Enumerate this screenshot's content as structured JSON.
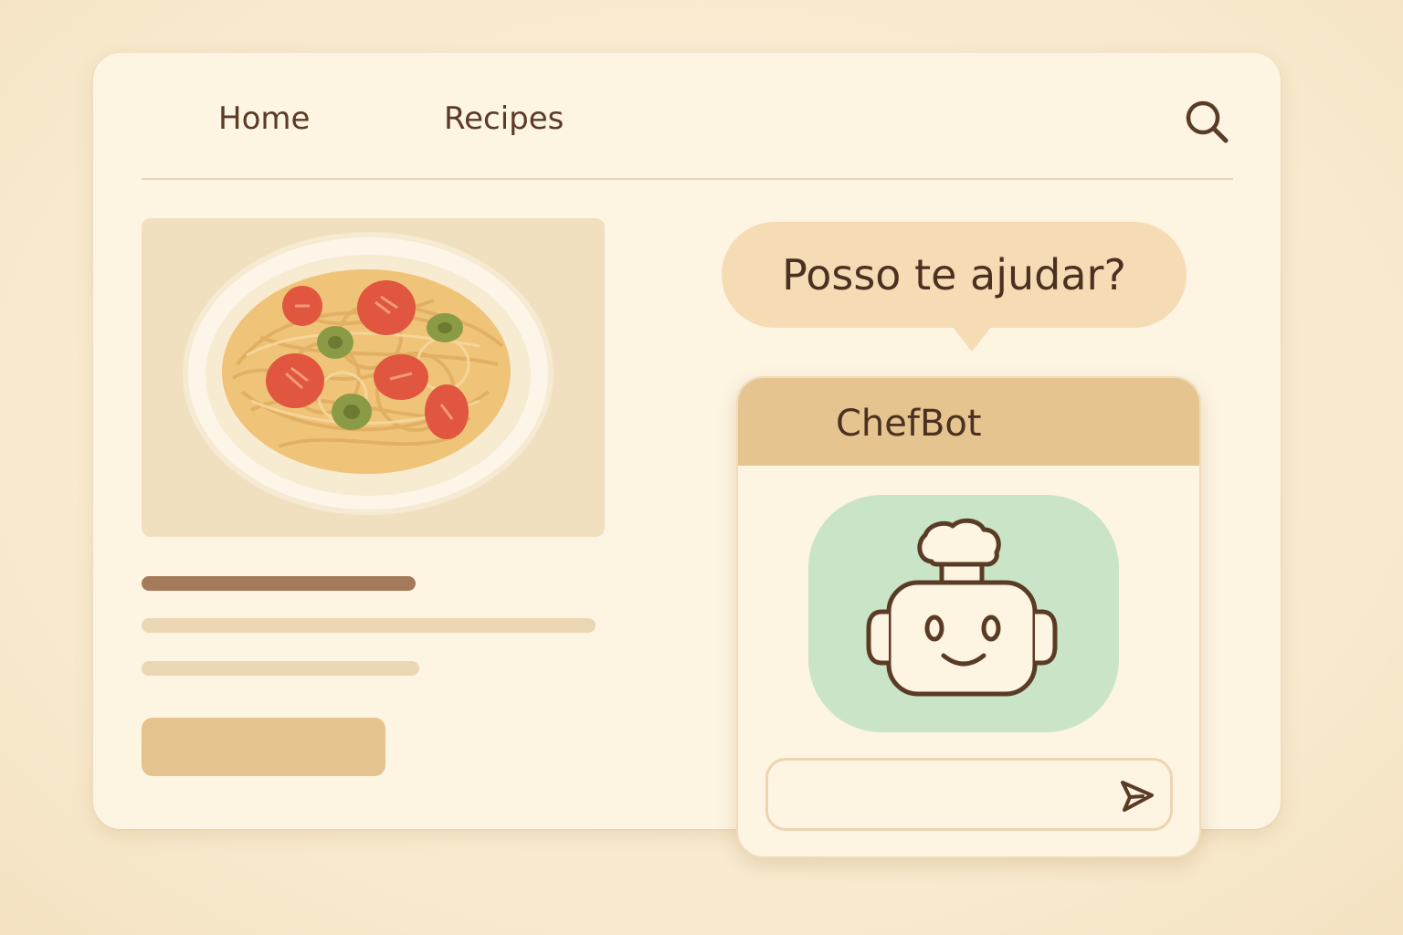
{
  "nav": {
    "home_label": "Home",
    "recipes_label": "Recipes",
    "search_icon": "search-icon"
  },
  "content": {
    "dish_image_alt": "pasta-dish-image",
    "action_button_label": ""
  },
  "chat": {
    "prompt_bubble": "Posso te ajudar?",
    "title": "ChefBot",
    "avatar_icon": "chef-robot-icon",
    "input_value": "",
    "input_placeholder": "",
    "send_icon": "send-icon"
  },
  "colors": {
    "background": "#f9ebcf",
    "card": "#fdf4e2",
    "accent": "#e5c48f",
    "bubble": "#f6dcb5",
    "text_dark": "#4b3121",
    "avatar_bg": "#c9e4c6",
    "tomato": "#e0563e",
    "olive": "#8a9a45"
  }
}
